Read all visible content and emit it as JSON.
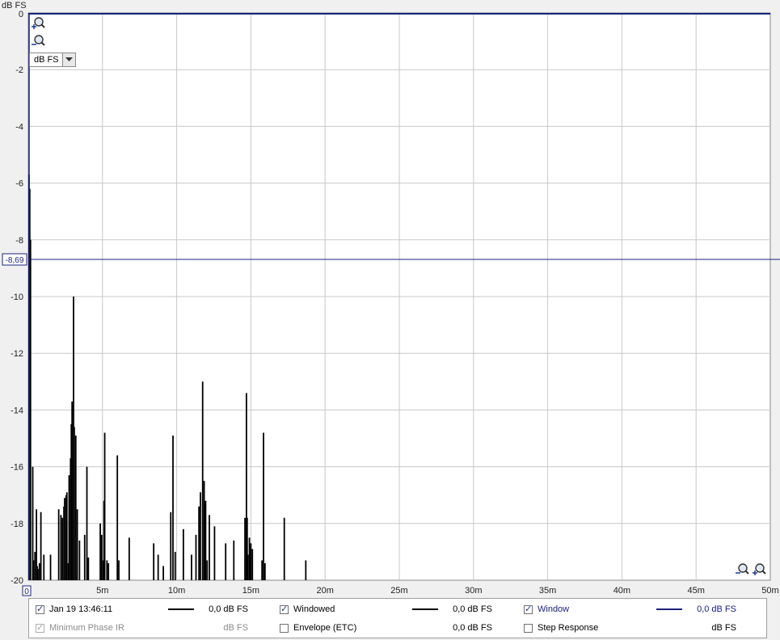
{
  "chart_data": {
    "type": "line",
    "title": "",
    "ylabel": "dB FS",
    "xlabel": "",
    "xlim": [
      0,
      50
    ],
    "ylim": [
      -20,
      0
    ],
    "x_ticks": [
      {
        "v": 0,
        "label": "0"
      },
      {
        "v": 5,
        "label": "5m"
      },
      {
        "v": 10,
        "label": "10m"
      },
      {
        "v": 15,
        "label": "15m"
      },
      {
        "v": 20,
        "label": "20m"
      },
      {
        "v": 25,
        "label": "25m"
      },
      {
        "v": 30,
        "label": "30m"
      },
      {
        "v": 35,
        "label": "35m"
      },
      {
        "v": 40,
        "label": "40m"
      },
      {
        "v": 45,
        "label": "45m"
      },
      {
        "v": 50,
        "label": "50m"
      }
    ],
    "y_ticks": [
      {
        "v": 0,
        "label": "0"
      },
      {
        "v": -2,
        "label": "-2"
      },
      {
        "v": -4,
        "label": "-4"
      },
      {
        "v": -6,
        "label": "-6"
      },
      {
        "v": -8,
        "label": "-8"
      },
      {
        "v": -10,
        "label": "-10"
      },
      {
        "v": -12,
        "label": "-12"
      },
      {
        "v": -14,
        "label": "-14"
      },
      {
        "v": -16,
        "label": "-16"
      },
      {
        "v": -18,
        "label": "-18"
      },
      {
        "v": -20,
        "label": "-20"
      }
    ],
    "cursor": {
      "y": -8.69,
      "label": "-8,69",
      "x_label": "0"
    },
    "grid": true,
    "series": [
      {
        "name": "Windowed",
        "color": "#000000",
        "spikes": [
          [
            0.05,
            -5.7
          ],
          [
            0.1,
            -6.2
          ],
          [
            0.15,
            -8.0
          ],
          [
            0.3,
            -16.0
          ],
          [
            0.35,
            -19.3
          ],
          [
            0.45,
            -19.0
          ],
          [
            0.55,
            -17.5
          ],
          [
            0.6,
            -19.5
          ],
          [
            0.65,
            -19.6
          ],
          [
            0.75,
            -19.4
          ],
          [
            0.85,
            -17.6
          ],
          [
            1.05,
            -19.1
          ],
          [
            1.5,
            -19.1
          ],
          [
            2.05,
            -17.5
          ],
          [
            2.2,
            -17.7
          ],
          [
            2.3,
            -17.8
          ],
          [
            2.4,
            -17.4
          ],
          [
            2.45,
            -17.1
          ],
          [
            2.55,
            -17.0
          ],
          [
            2.6,
            -16.9
          ],
          [
            2.7,
            -19.4
          ],
          [
            2.75,
            -16.3
          ],
          [
            2.85,
            -15.7
          ],
          [
            2.9,
            -14.5
          ],
          [
            2.95,
            -13.7
          ],
          [
            3.05,
            -10.0
          ],
          [
            3.1,
            -14.6
          ],
          [
            3.2,
            -14.9
          ],
          [
            3.3,
            -17.5
          ],
          [
            3.45,
            -18.6
          ],
          [
            3.8,
            -18.4
          ],
          [
            3.95,
            -16.0
          ],
          [
            4.05,
            -19.2
          ],
          [
            4.85,
            -18.0
          ],
          [
            4.95,
            -18.4
          ],
          [
            5.05,
            -19.3
          ],
          [
            5.1,
            -17.2
          ],
          [
            5.15,
            -14.8
          ],
          [
            5.3,
            -19.3
          ],
          [
            5.4,
            -19.4
          ],
          [
            6.0,
            -15.6
          ],
          [
            6.1,
            -19.3
          ],
          [
            6.8,
            -18.5
          ],
          [
            8.45,
            -18.7
          ],
          [
            8.75,
            -19.1
          ],
          [
            9.1,
            -19.5
          ],
          [
            9.6,
            -17.6
          ],
          [
            9.75,
            -14.9
          ],
          [
            9.9,
            -19.0
          ],
          [
            10.45,
            -18.2
          ],
          [
            11.0,
            -19.1
          ],
          [
            11.3,
            -18.4
          ],
          [
            11.5,
            -17.4
          ],
          [
            11.6,
            -16.9
          ],
          [
            11.75,
            -13.0
          ],
          [
            11.85,
            -16.5
          ],
          [
            11.95,
            -17.2
          ],
          [
            12.05,
            -19.3
          ],
          [
            12.2,
            -17.7
          ],
          [
            12.55,
            -18.1
          ],
          [
            13.3,
            -18.7
          ],
          [
            13.85,
            -18.6
          ],
          [
            14.6,
            -17.8
          ],
          [
            14.7,
            -13.4
          ],
          [
            14.75,
            -17.8
          ],
          [
            14.8,
            -19.1
          ],
          [
            14.9,
            -18.5
          ],
          [
            15.0,
            -18.7
          ],
          [
            15.1,
            -18.9
          ],
          [
            15.75,
            -19.3
          ],
          [
            15.85,
            -14.8
          ],
          [
            15.95,
            -19.4
          ],
          [
            17.25,
            -17.8
          ],
          [
            18.7,
            -19.3
          ]
        ]
      },
      {
        "name": "Window",
        "color": "#1a237e",
        "note": "flat at 0 dB FS"
      }
    ]
  },
  "unit_selector": {
    "value": "dB FS"
  },
  "icons": {
    "zoom_in": "zoom-in-icon",
    "zoom_out": "zoom-out-icon",
    "dropdown": "chevron-down-icon"
  },
  "legend": {
    "items": [
      {
        "label": "Jan 19 13:46:11",
        "checked": true,
        "enabled": true,
        "value": "0,0 dB FS",
        "line_color": "#000000"
      },
      {
        "label": "Windowed",
        "checked": true,
        "enabled": true,
        "value": "0,0 dB FS",
        "line_color": "#000000"
      },
      {
        "label": "Window",
        "checked": true,
        "enabled": true,
        "value": "0,0 dB FS",
        "line_color": "#1a237e",
        "label_color": "#1a237e"
      },
      {
        "label": "Minimum Phase IR",
        "checked": true,
        "enabled": false,
        "value": "dB FS"
      },
      {
        "label": "Envelope (ETC)",
        "checked": false,
        "enabled": true,
        "value": "0,0 dB FS"
      },
      {
        "label": "Step Response",
        "checked": false,
        "enabled": true,
        "value": "dB FS"
      }
    ]
  }
}
